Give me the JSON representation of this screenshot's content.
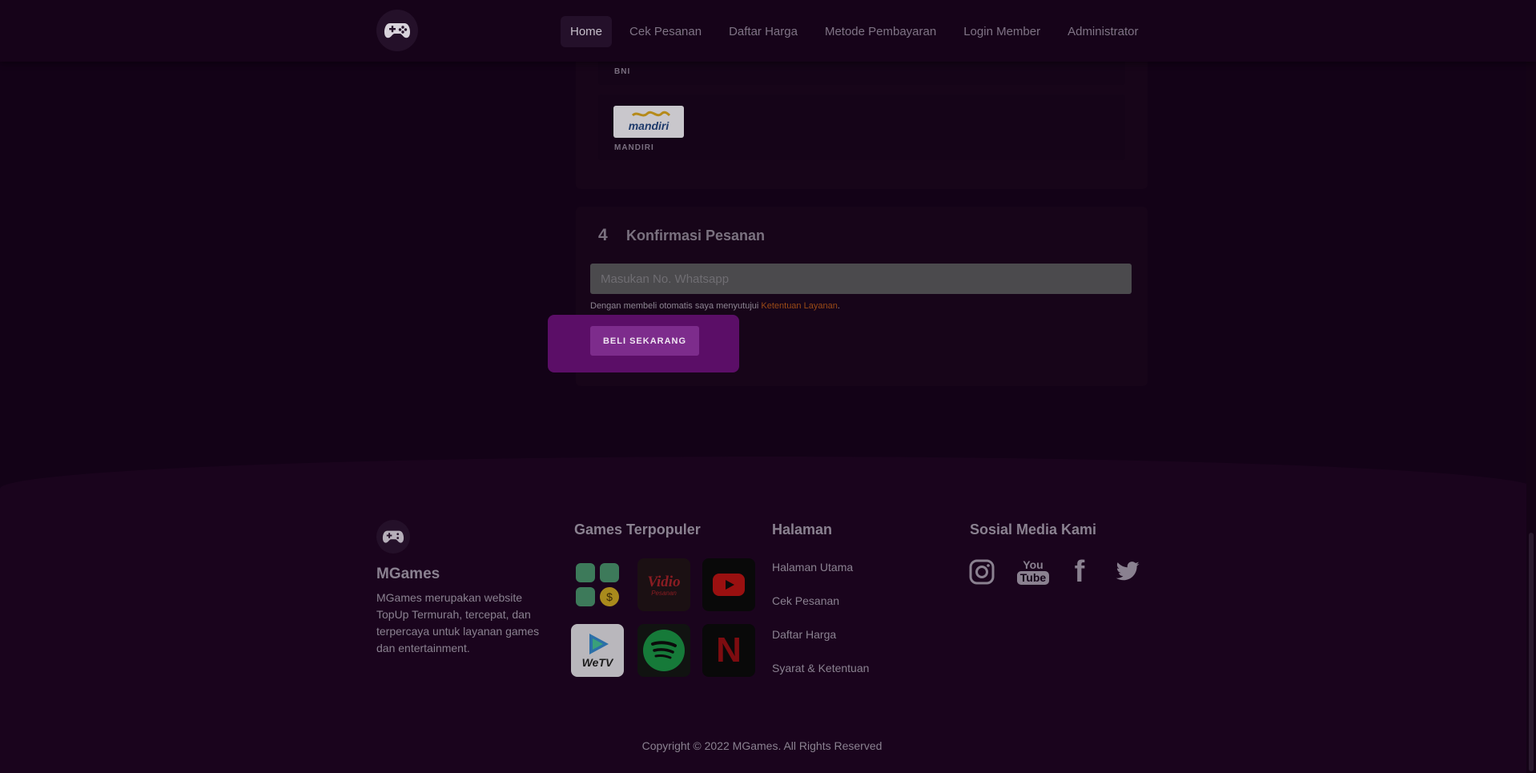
{
  "nav": {
    "logo_icon": "gamepad-icon",
    "links": [
      {
        "label": "Home",
        "active": true
      },
      {
        "label": "Cek Pesanan",
        "active": false
      },
      {
        "label": "Daftar Harga",
        "active": false
      },
      {
        "label": "Metode Pembayaran",
        "active": false
      },
      {
        "label": "Login Member",
        "active": false
      },
      {
        "label": "Administrator",
        "active": false
      }
    ]
  },
  "payment": {
    "banks": [
      {
        "label": "BNI"
      },
      {
        "label": "MANDIRI",
        "logo_text": "mandiri"
      }
    ]
  },
  "confirm": {
    "step": "4",
    "title": "Konfirmasi Pesanan",
    "whatsapp_placeholder": "Masukan No. Whatsapp",
    "whatsapp_value": "",
    "terms_prefix": "Dengan membeli otomatis saya menyutujui ",
    "terms_link": "Ketentuan Layanan",
    "terms_suffix": ".",
    "buy_label": "BELI SEKARANG"
  },
  "footer": {
    "brand": "MGames",
    "description": "MGames merupakan website TopUp Termurah, tercepat, dan terpercaya untuk layanan games dan entertainment.",
    "games_heading": "Games Terpopuler",
    "games": [
      {
        "icon": "app-bundle-icon"
      },
      {
        "icon": "vidio-icon",
        "text": "Vidio",
        "subtext": "Pesanan"
      },
      {
        "icon": "youtube-icon"
      },
      {
        "icon": "wetv-icon",
        "text": "WeTV"
      },
      {
        "icon": "spotify-icon"
      },
      {
        "icon": "netflix-icon",
        "text": "N"
      }
    ],
    "pages_heading": "Halaman",
    "pages": [
      "Halaman Utama",
      "Cek Pesanan",
      "Daftar Harga",
      "Syarat & Ketentuan"
    ],
    "social_heading": "Sosial Media Kami",
    "social": [
      {
        "icon": "instagram-icon"
      },
      {
        "icon": "youtube-icon",
        "text_top": "You",
        "text_bottom": "Tube"
      },
      {
        "icon": "facebook-icon",
        "text": "f"
      },
      {
        "icon": "twitter-icon"
      }
    ],
    "copyright": "Copyright © 2022 MGames. All Rights Reserved"
  },
  "colors": {
    "background": "#130217",
    "accent": "#7d2c8c",
    "highlight": "#5b0e67",
    "link": "#9a4a16"
  }
}
